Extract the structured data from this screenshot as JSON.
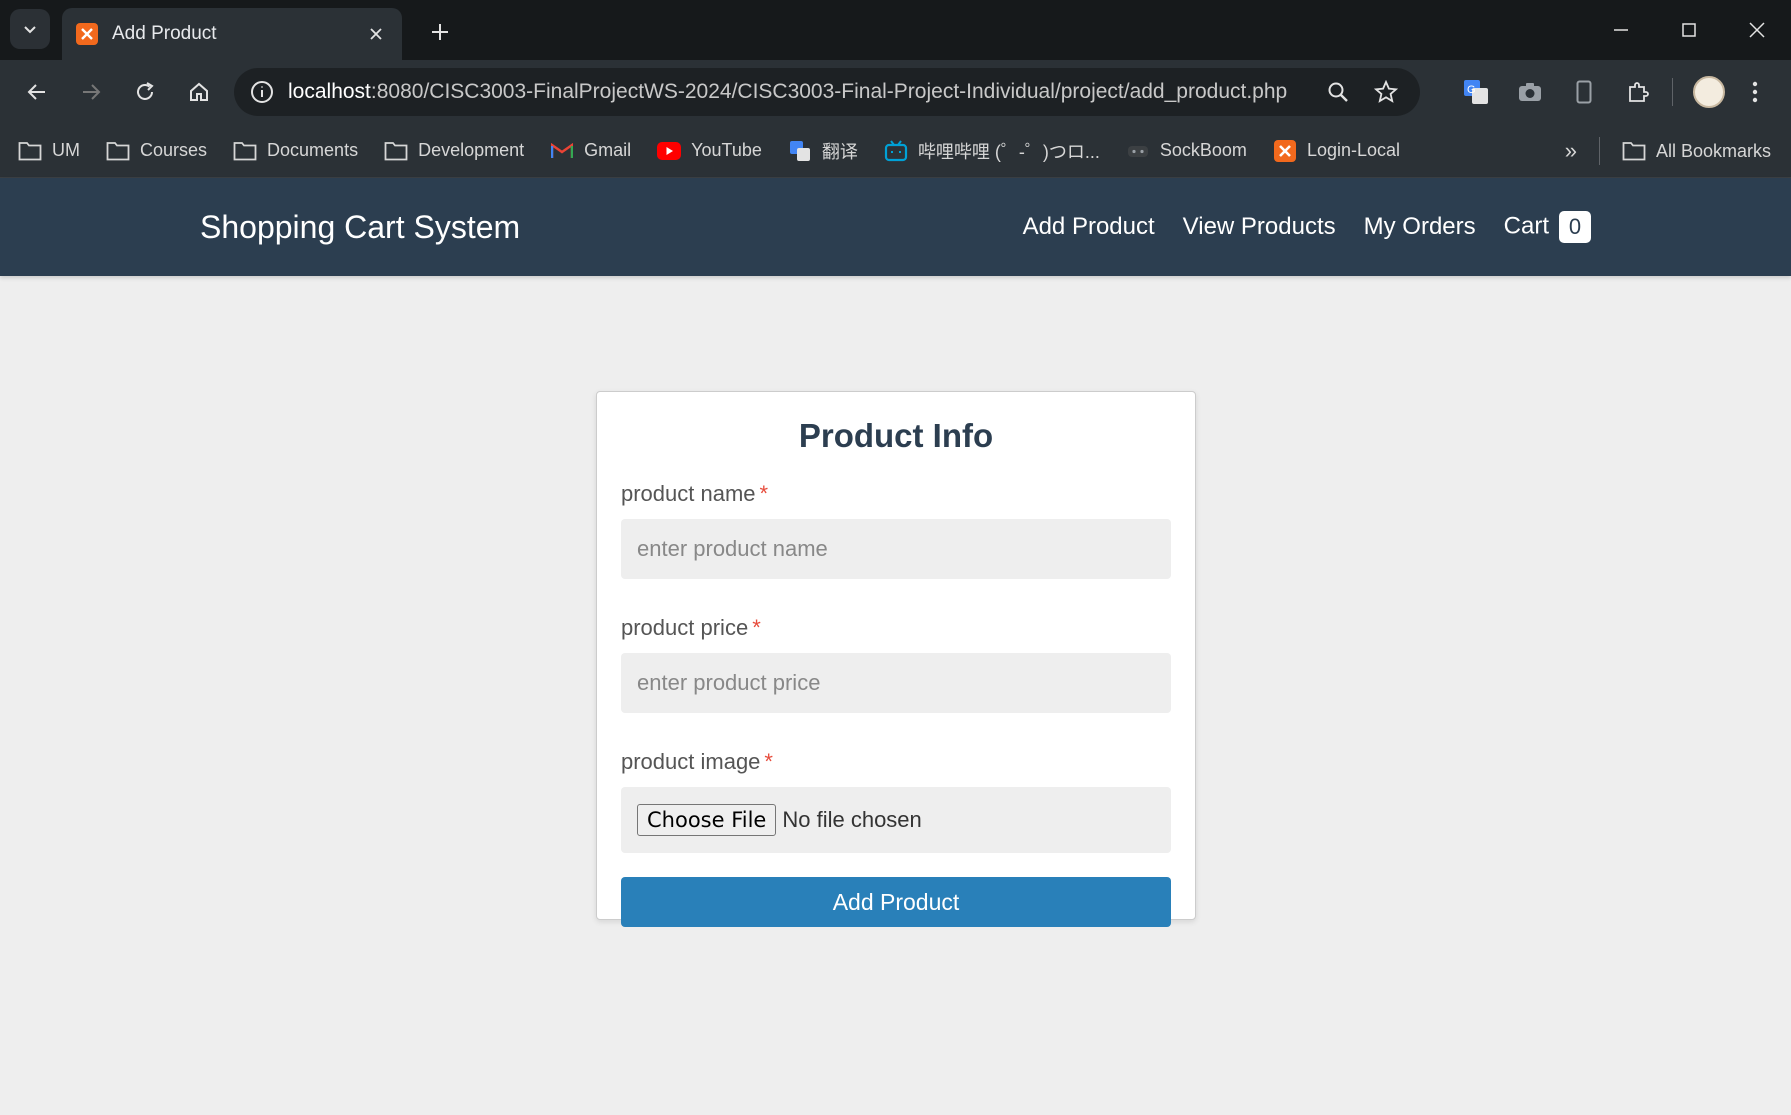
{
  "browser": {
    "tab_title": "Add Product",
    "url_host": "localhost",
    "url_rest": ":8080/CISC3003-FinalProjectWS-2024/CISC3003-Final-Project-Individual/project/add_product.php",
    "bookmarks": [
      {
        "label": "UM",
        "icon": "folder-icon"
      },
      {
        "label": "Courses",
        "icon": "folder-icon"
      },
      {
        "label": "Documents",
        "icon": "folder-icon"
      },
      {
        "label": "Development",
        "icon": "folder-icon"
      },
      {
        "label": "Gmail",
        "icon": "gmail-icon"
      },
      {
        "label": "YouTube",
        "icon": "youtube-icon"
      },
      {
        "label": "翻译",
        "icon": "translate-icon"
      },
      {
        "label": "哔哩哔哩 (゜-゜)つロ...",
        "icon": "bilibili-icon"
      },
      {
        "label": "SockBoom",
        "icon": "sockboom-icon"
      },
      {
        "label": "Login-Local",
        "icon": "xampp-icon"
      }
    ],
    "all_bookmarks": "All Bookmarks",
    "more_bookmarks": "»"
  },
  "site": {
    "brand": "Shopping Cart System",
    "nav": {
      "add_product": "Add Product",
      "view_products": "View Products",
      "my_orders": "My Orders",
      "cart": "Cart",
      "cart_count": "0"
    }
  },
  "form": {
    "title": "Product Info",
    "required_mark": "*",
    "name_label": "product name",
    "name_placeholder": "enter product name",
    "price_label": "product price",
    "price_placeholder": "enter product price",
    "image_label": "product image",
    "file_button": "Choose File",
    "file_status": "No file chosen",
    "submit": "Add Product"
  },
  "colors": {
    "navbar": "#2c3e50",
    "submit": "#2980b9",
    "required": "#e74c3c"
  }
}
